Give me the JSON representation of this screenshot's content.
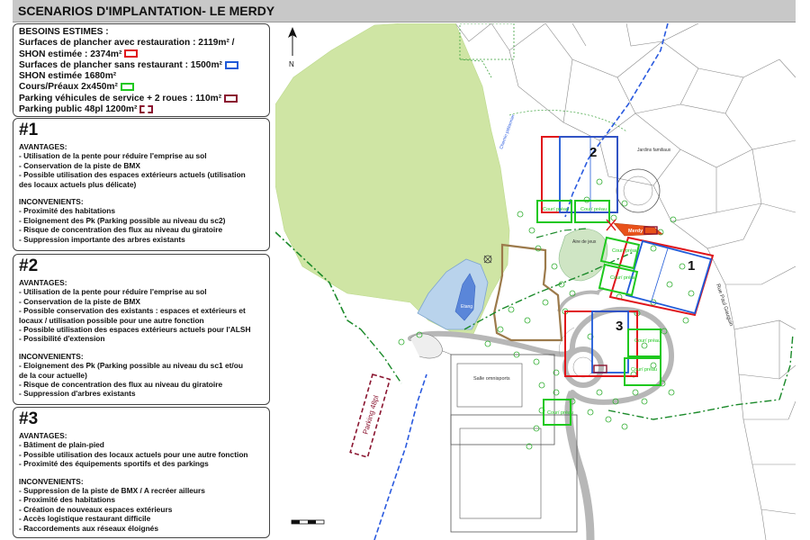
{
  "title": "SCENARIOS D'IMPLANTATION- LE MERDY",
  "besoins": {
    "heading": "BESOINS ESTIMES :",
    "lines": [
      {
        "text": "Surfaces de plancher avec restauration : 2119m² /",
        "swatch": null
      },
      {
        "text": "SHON estimée : 2374m²",
        "swatch": {
          "color": "#e0151b",
          "style": "solid"
        }
      },
      {
        "text": "Surfaces de plancher sans restaurant : 1500m²",
        "swatch": {
          "color": "#1f5ad8",
          "style": "solid"
        }
      },
      {
        "text": "SHON estimée 1680m²",
        "swatch": null
      },
      {
        "text": "Cours/Préaux 2x450m²",
        "swatch": {
          "color": "#1ec81e",
          "style": "solid"
        }
      },
      {
        "text": "Parking véhicules de service + 2 roues : 110m²",
        "swatch": {
          "color": "#8a1530",
          "style": "solid"
        }
      },
      {
        "text": "Parking public 48pl 1200m²",
        "swatch": {
          "color": "#8a1530",
          "style": "dashed"
        }
      }
    ]
  },
  "scenarios": [
    {
      "number": "#1",
      "avantages_label": "AVANTAGES:",
      "avantages": [
        "- Utilisation de la pente pour réduire l'emprise au sol",
        "- Conservation de la piste de BMX",
        "- Possible utilisation des espaces extérieurs actuels (utilisation",
        "des locaux actuels plus délicate)"
      ],
      "inconvenients_label": "INCONVENIENTS:",
      "inconvenients": [
        "- Proximité des habitations",
        "- Eloignement des Pk (Parking possible au niveau du sc2)",
        "- Risque de concentration des flux au niveau du giratoire",
        "- Suppression importante des arbres existants"
      ]
    },
    {
      "number": "#2",
      "avantages_label": "AVANTAGES:",
      "avantages": [
        "- Utilisation de la pente pour réduire l'emprise au sol",
        "- Conservation de la piste de BMX",
        "- Possible conservation des existants : espaces et extérieurs et",
        "locaux / utilisation possible pour une autre fonction",
        "- Possible utilisation des espaces extérieurs actuels pour l'ALSH",
        "- Possibilité d'extension"
      ],
      "inconvenients_label": "INCONVENIENTS:",
      "inconvenients": [
        "- Eloignement des Pk (Parking possible au niveau du sc1 et/ou",
        "de la cour actuelle)",
        "- Risque de concentration des flux au niveau du giratoire",
        "- Suppression d'arbres existants"
      ]
    },
    {
      "number": "#3",
      "avantages_label": "AVANTAGES:",
      "avantages": [
        "- Bâtiment de plain-pied",
        "- Possible utilisation des locaux actuels pour une autre fonction",
        "- Proximité des équipements sportifs et des parkings"
      ],
      "inconvenients_label": "INCONVENIENTS:",
      "inconvenients": [
        "- Suppression de la piste de BMX / A recréer ailleurs",
        "- Proximité des habitations",
        "- Création de nouveaux espaces extérieurs",
        "- Accès logistique restaurant difficile",
        "- Raccordements aux réseaux éloignés"
      ]
    }
  ],
  "map": {
    "north_label": "N",
    "zone_labels": {
      "z1": "1",
      "z2": "2",
      "z3": "3"
    },
    "cour_preau": "Cour/ préau",
    "merdy": "Merdy",
    "parking48": "Parking 48pl",
    "salle_omnisports": "Salle omnisports",
    "aire_de_jeux": "Aire de jeux",
    "jardins": "Jardins familiaux",
    "etang": "Etang",
    "rue": "Rue Paul Gauguin",
    "chemin": "Chemin piétonnier",
    "colors": {
      "red": "#e0151b",
      "blue": "#1f5ad8",
      "green": "#1ec81e",
      "maroon": "#8a1530",
      "orange": "#e8511a",
      "wood": "#cfe5a4"
    }
  }
}
